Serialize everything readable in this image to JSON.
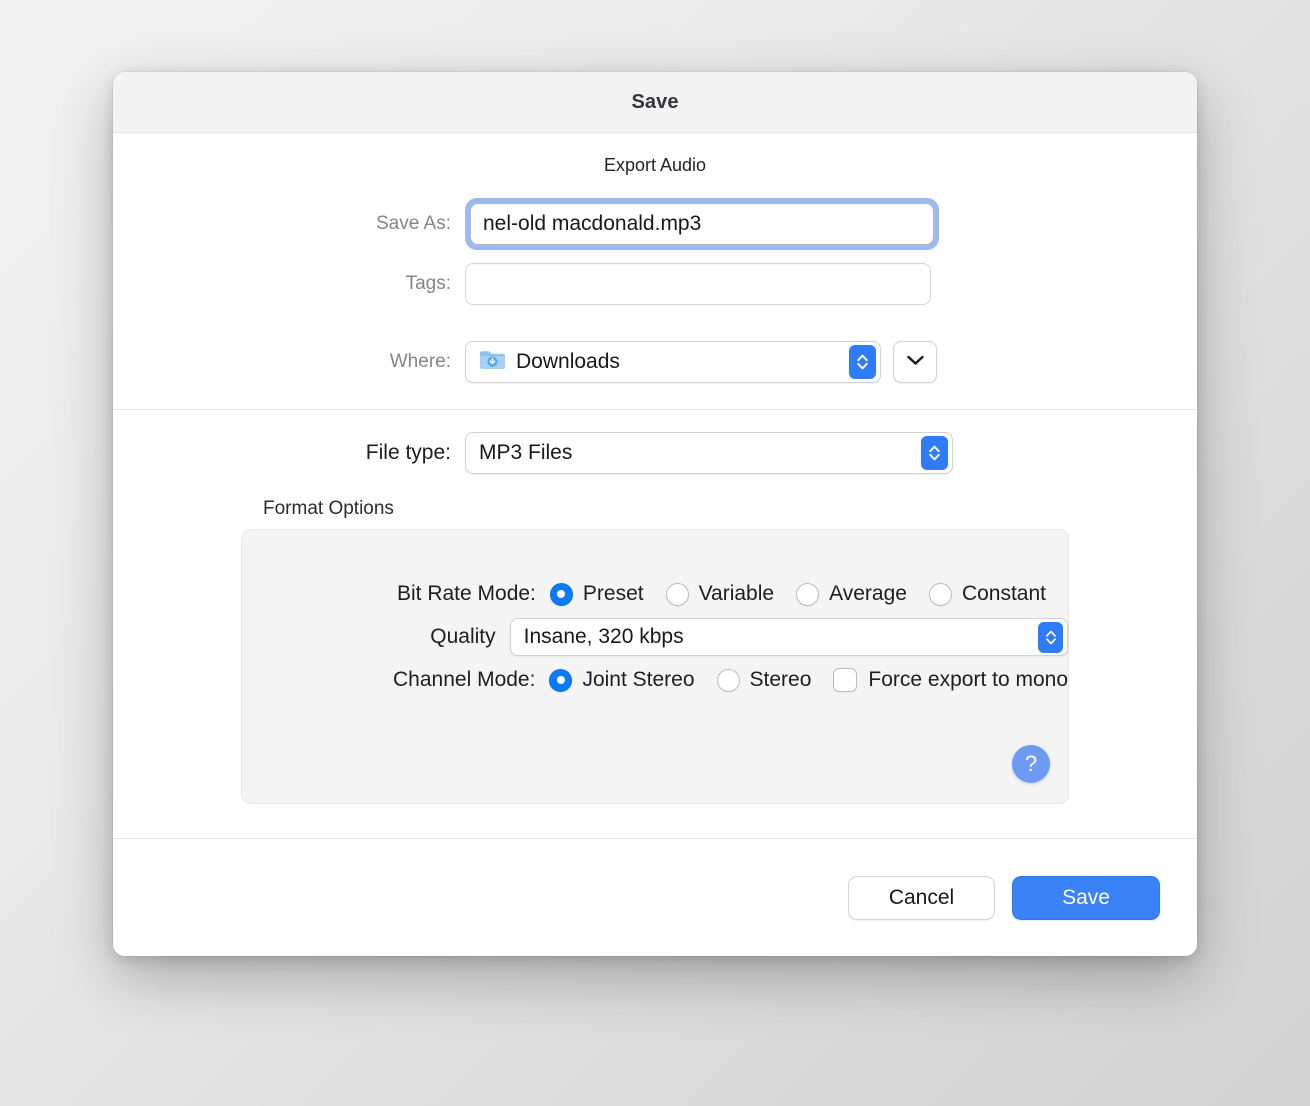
{
  "window": {
    "title": "Save"
  },
  "top": {
    "heading": "Export Audio",
    "save_as": {
      "label": "Save As:",
      "value": "nel-old macdonald.mp3",
      "placeholder": ""
    },
    "tags": {
      "label": "Tags:",
      "value": "",
      "placeholder": ""
    },
    "where": {
      "label": "Where:",
      "value": "Downloads",
      "folder_icon": "downloads-folder-icon",
      "stepper_icon": "up-down-chevron-icon",
      "expand_icon": "chevron-down-icon"
    }
  },
  "file_type": {
    "label": "File type:",
    "value": "MP3 Files",
    "stepper_icon": "up-down-chevron-icon"
  },
  "format_options": {
    "group_title": "Format Options",
    "bit_rate_mode": {
      "label": "Bit Rate Mode:",
      "options": [
        {
          "label": "Preset",
          "selected": true
        },
        {
          "label": "Variable",
          "selected": false
        },
        {
          "label": "Average",
          "selected": false
        },
        {
          "label": "Constant",
          "selected": false
        }
      ]
    },
    "quality": {
      "label": "Quality",
      "value": "Insane, 320 kbps",
      "stepper_icon": "up-down-chevron-icon"
    },
    "channel_mode": {
      "label": "Channel Mode:",
      "options": [
        {
          "label": "Joint Stereo",
          "selected": true
        },
        {
          "label": "Stereo",
          "selected": false
        }
      ],
      "force_mono": {
        "label": "Force export to mono",
        "checked": false
      }
    },
    "help": {
      "icon": "question-mark-icon",
      "label": "?"
    }
  },
  "actions": {
    "cancel_label": "Cancel",
    "save_label": "Save"
  },
  "colors": {
    "accent": "#3b82f6",
    "control_blue": "#2f7cf6",
    "radio_blue": "#0b7bf7",
    "focus_ring": "#9eb9f0",
    "help_blue": "#6d9bf3"
  }
}
